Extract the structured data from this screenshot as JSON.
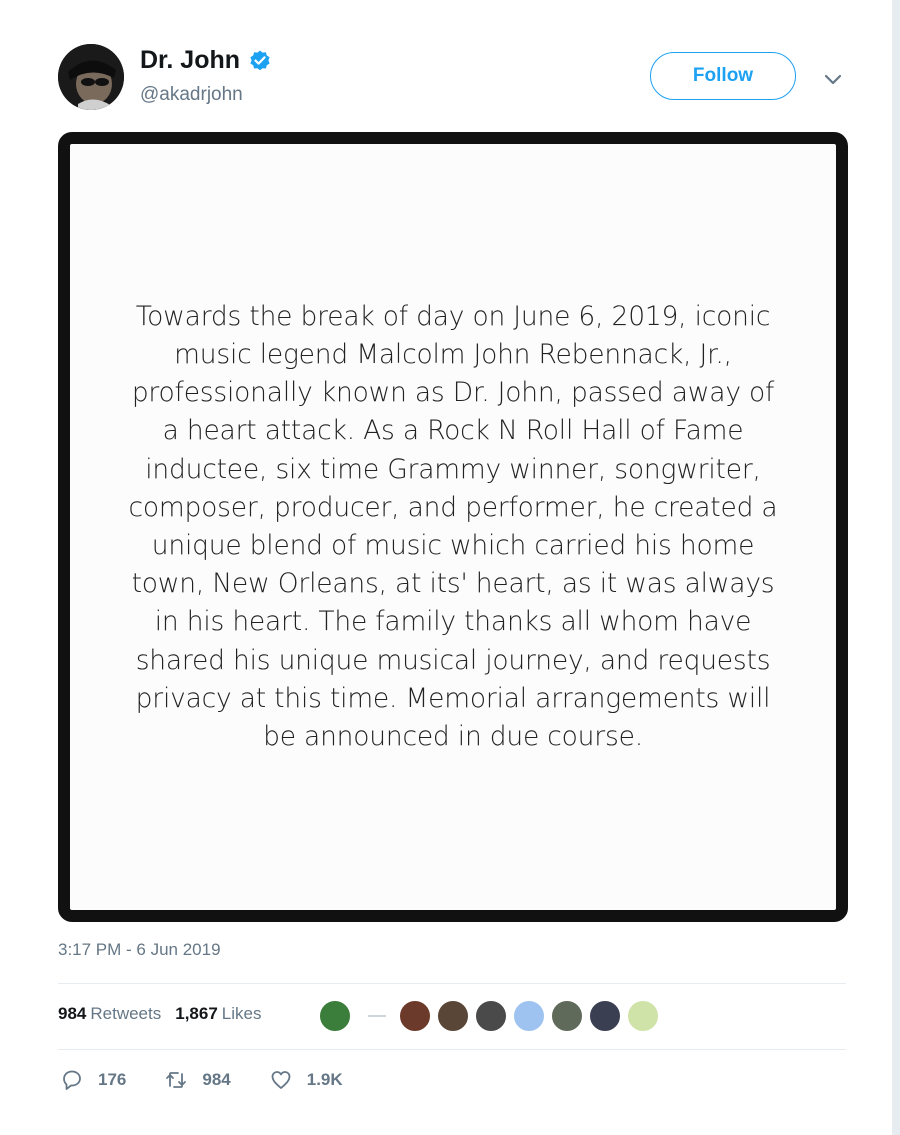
{
  "header": {
    "display_name": "Dr. John",
    "handle": "@akadrjohn",
    "follow_label": "Follow"
  },
  "media": {
    "statement_lines": [
      "Towards the break of day on June 6, 2019, iconic",
      "music legend Malcolm John Rebennack, Jr.,",
      "professionally known as Dr. John, passed away of",
      "a heart attack. As a Rock N Roll Hall of Fame",
      "inductee, six time Grammy winner, songwriter,",
      "composer, producer, and performer, he created a",
      "unique blend of music which carried his home",
      "town, New Orleans, at its' heart, as it was always",
      "in his heart. The family thanks all whom have",
      "shared his unique musical journey, and requests",
      "privacy at this time. Memorial arrangements will",
      "be announced in due course."
    ]
  },
  "timestamp": "3:17 PM - 6 Jun 2019",
  "stats": {
    "retweets_count": "984",
    "retweets_label": "Retweets",
    "likes_count": "1,867",
    "likes_label": "Likes"
  },
  "likers": {
    "avatar_colors": [
      "#3b7d3a",
      "#6b3a2a",
      "#5a4636",
      "#4a4a4a",
      "#9ec3f0",
      "#5f6a5a",
      "#3a3f52",
      "#cfe3a8"
    ]
  },
  "actions": {
    "replies": "176",
    "retweets": "984",
    "likes": "1.9K"
  },
  "colors": {
    "accent": "#1da1f2",
    "secondary_text": "#657786"
  }
}
